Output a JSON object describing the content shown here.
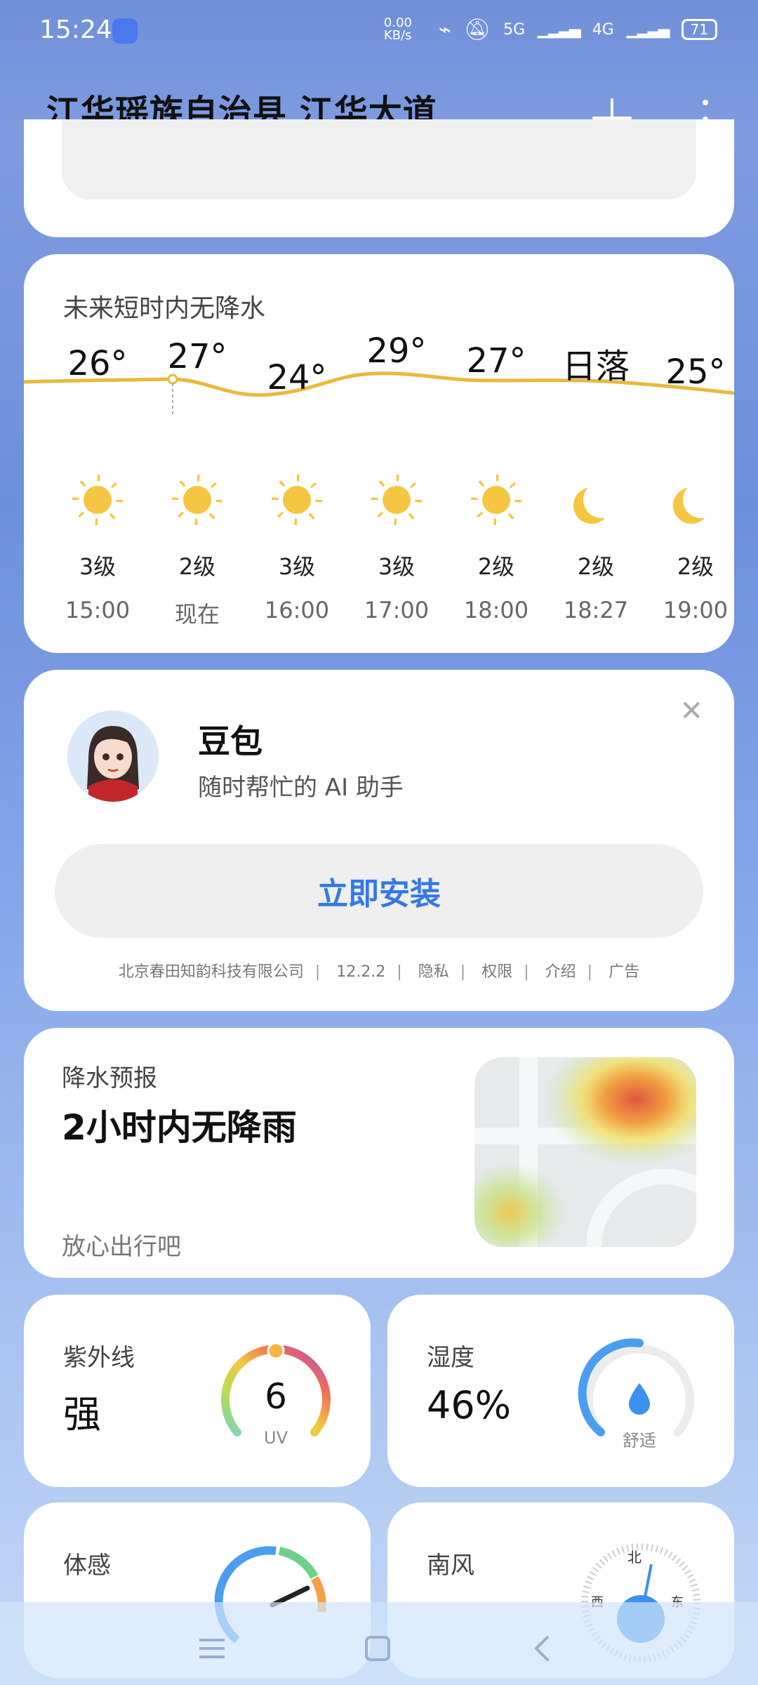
{
  "status": {
    "time": "15:24",
    "net_speed": "0.00 KB/s",
    "sig1": "5G",
    "sig2": "4G",
    "battery": "71"
  },
  "header": {
    "location": "江华瑶族自治县 江华大道"
  },
  "hourly": {
    "title": "未来短时内无降水",
    "items": [
      {
        "temp": "26°",
        "icon": "sun-icon",
        "wind": "3级",
        "time": "15:00"
      },
      {
        "temp": "27°",
        "icon": "sun-icon",
        "wind": "2级",
        "time": "现在"
      },
      {
        "temp": "24°",
        "icon": "sun-icon",
        "wind": "3级",
        "time": "16:00"
      },
      {
        "temp": "29°",
        "icon": "sun-icon",
        "wind": "3级",
        "time": "17:00"
      },
      {
        "temp": "27°",
        "icon": "sun-icon",
        "wind": "2级",
        "time": "18:00"
      },
      {
        "temp": "日落",
        "icon": "moon-icon",
        "wind": "2级",
        "time": "18:27"
      },
      {
        "temp": "25°",
        "icon": "moon-icon",
        "wind": "2级",
        "time": "19:00"
      }
    ]
  },
  "ad": {
    "title": "豆包",
    "subtitle": "随时帮忙的 AI 助手",
    "install_label": "立即安装",
    "publisher": "北京春田知韵科技有限公司",
    "version": "12.2.2",
    "privacy": "隐私",
    "permissions": "权限",
    "intro": "介绍",
    "ad_tag": "广告"
  },
  "precip": {
    "label": "降水预报",
    "title": "2小时内无降雨",
    "subtitle": "放心出行吧"
  },
  "uv": {
    "label": "紫外线",
    "value": "强",
    "index": "6",
    "unit": "UV"
  },
  "humidity": {
    "label": "湿度",
    "value": "46%",
    "comfort": "舒适"
  },
  "feels": {
    "label": "体感"
  },
  "wind": {
    "label": "南风",
    "north": "北",
    "west": "西",
    "east": "东"
  },
  "colors": {
    "accent": "#3478e5",
    "sun": "#f5c642",
    "curve": "#e8b93c"
  }
}
